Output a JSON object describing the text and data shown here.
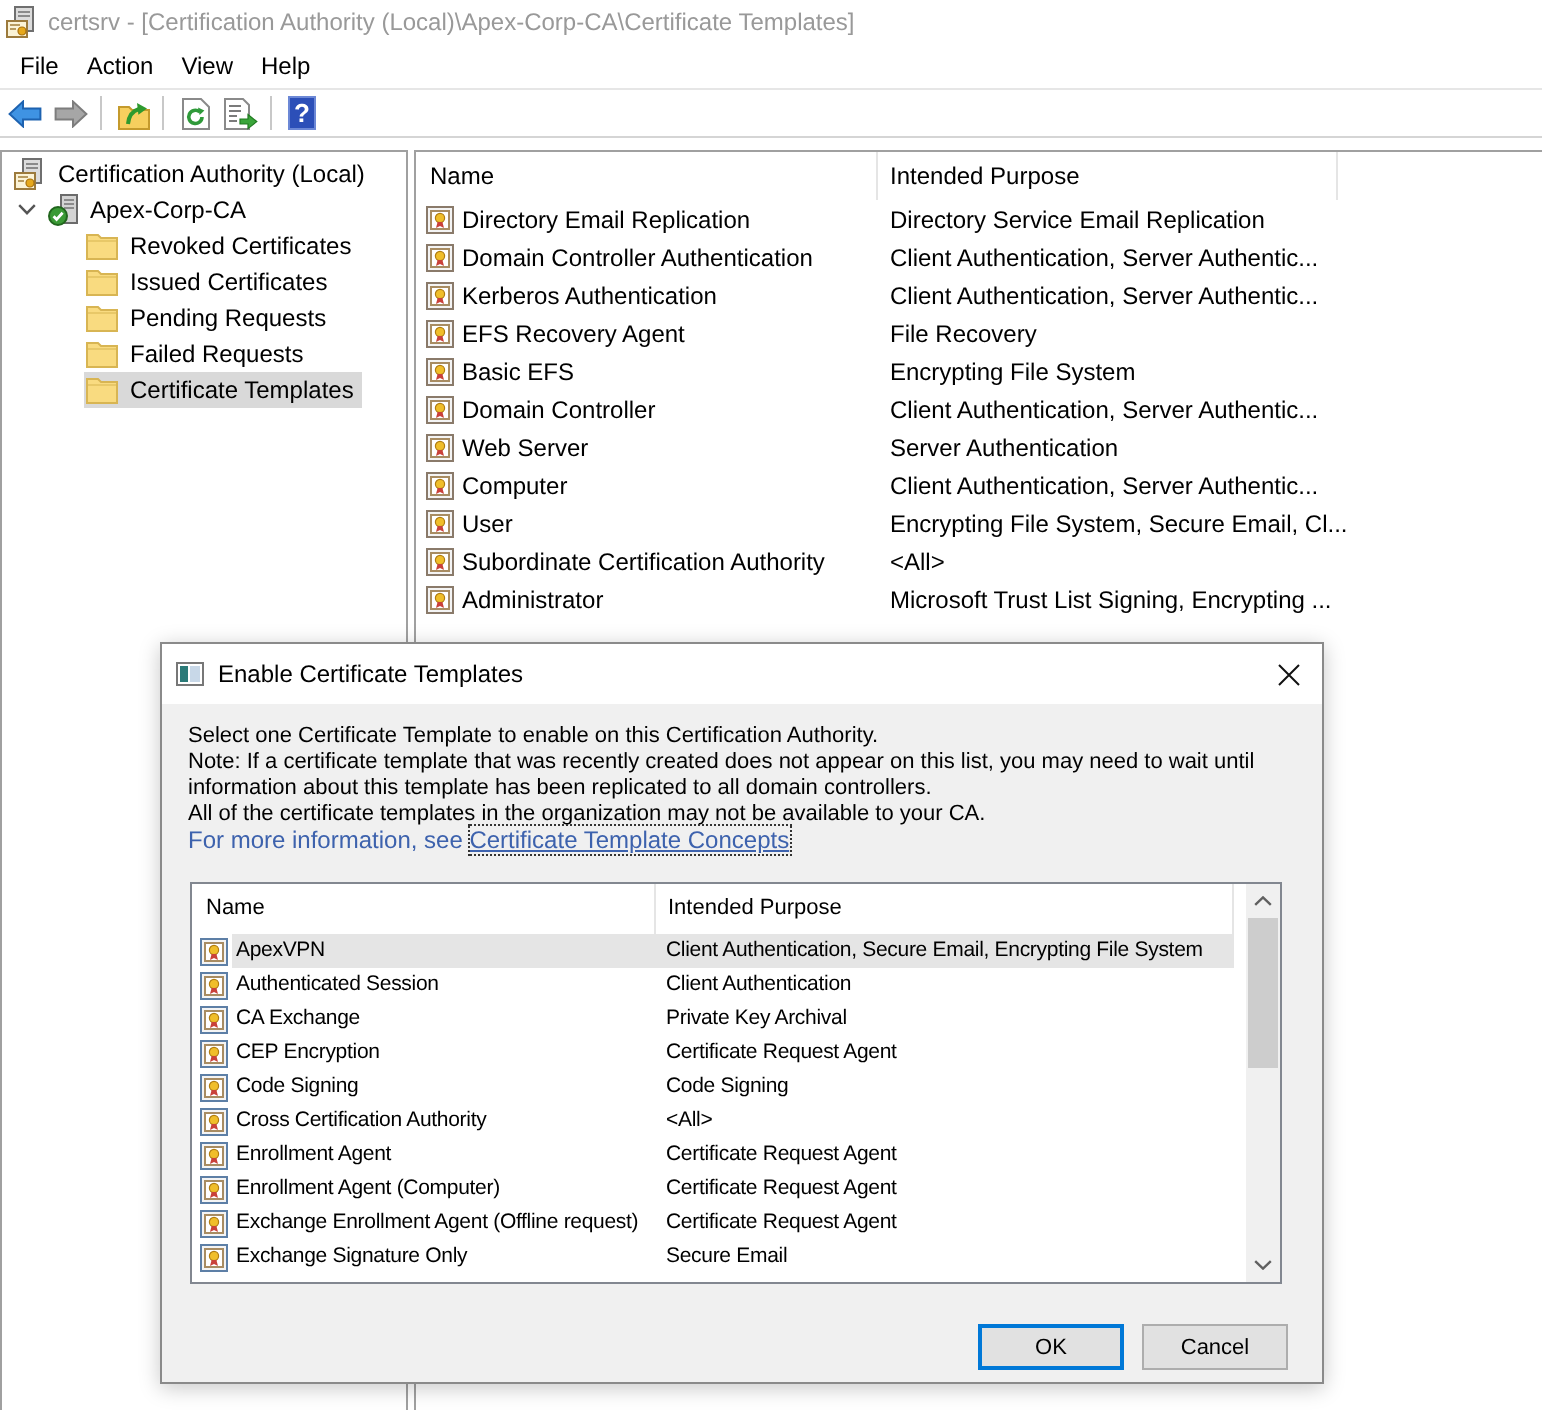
{
  "window": {
    "title": "certsrv - [Certification Authority (Local)\\Apex-Corp-CA\\Certificate Templates]",
    "active": false
  },
  "menu": [
    "File",
    "Action",
    "View",
    "Help"
  ],
  "toolbar": {
    "groups": [
      [
        {
          "kind": "back",
          "disabled": false
        },
        {
          "kind": "forward",
          "disabled": true
        }
      ],
      [
        {
          "kind": "up",
          "disabled": false
        }
      ],
      [
        {
          "kind": "refresh",
          "disabled": false
        },
        {
          "kind": "export",
          "disabled": false
        }
      ],
      [
        {
          "kind": "help",
          "disabled": false,
          "glyph": "?"
        }
      ]
    ]
  },
  "tree": [
    {
      "kind": "root",
      "label": "Certification Authority (Local)",
      "selected": false,
      "children": [
        {
          "kind": "server",
          "label": "Apex-Corp-CA",
          "selected": false,
          "expanded": true,
          "children": [
            {
              "kind": "folder",
              "label": "Revoked Certificates",
              "selected": false
            },
            {
              "kind": "folder",
              "label": "Issued Certificates",
              "selected": false
            },
            {
              "kind": "folder",
              "label": "Pending Requests",
              "selected": false
            },
            {
              "kind": "folder",
              "label": "Failed Requests",
              "selected": false
            },
            {
              "kind": "folder",
              "label": "Certificate Templates",
              "selected": true
            }
          ]
        }
      ]
    }
  ],
  "list": {
    "columns": [
      "Name",
      "Intended Purpose"
    ],
    "rows": [
      {
        "name": "Directory Email Replication",
        "purpose": "Directory Service Email Replication",
        "selected": false
      },
      {
        "name": "Domain Controller Authentication",
        "purpose": "Client Authentication, Server Authentic...",
        "selected": false
      },
      {
        "name": "Kerberos Authentication",
        "purpose": "Client Authentication, Server Authentic...",
        "selected": false
      },
      {
        "name": "EFS Recovery Agent",
        "purpose": "File Recovery",
        "selected": false
      },
      {
        "name": "Basic EFS",
        "purpose": "Encrypting File System",
        "selected": false
      },
      {
        "name": "Domain Controller",
        "purpose": "Client Authentication, Server Authentic...",
        "selected": false
      },
      {
        "name": "Web Server",
        "purpose": "Server Authentication",
        "selected": false
      },
      {
        "name": "Computer",
        "purpose": "Client Authentication, Server Authentic...",
        "selected": false
      },
      {
        "name": "User",
        "purpose": "Encrypting File System, Secure Email, Cl...",
        "selected": false
      },
      {
        "name": "Subordinate Certification Authority",
        "purpose": "<All>",
        "selected": false
      },
      {
        "name": "Administrator",
        "purpose": "Microsoft Trust List Signing, Encrypting ...",
        "selected": false
      }
    ]
  },
  "dialog": {
    "title": "Enable Certificate Templates",
    "message": [
      "Select one Certificate Template to enable on this Certification Authority.",
      "Note: If a certificate template that was recently created does not appear on this list, you may need to wait until information about this template has been replicated to all domain controllers.",
      "All of the certificate templates in the organization may not be available to your CA."
    ],
    "more_info": {
      "text": "For more information, see",
      "link": "Certificate Template Concepts"
    },
    "list": {
      "columns": [
        "Name",
        "Intended Purpose"
      ],
      "rows": [
        {
          "name": "ApexVPN",
          "purpose": "Client Authentication, Secure Email, Encrypting File System",
          "selected": true
        },
        {
          "name": "Authenticated Session",
          "purpose": "Client Authentication",
          "selected": false
        },
        {
          "name": "CA Exchange",
          "purpose": "Private Key Archival",
          "selected": false
        },
        {
          "name": "CEP Encryption",
          "purpose": "Certificate Request Agent",
          "selected": false
        },
        {
          "name": "Code Signing",
          "purpose": "Code Signing",
          "selected": false
        },
        {
          "name": "Cross Certification Authority",
          "purpose": "<All>",
          "selected": false
        },
        {
          "name": "Enrollment Agent",
          "purpose": "Certificate Request Agent",
          "selected": false
        },
        {
          "name": "Enrollment Agent (Computer)",
          "purpose": "Certificate Request Agent",
          "selected": false
        },
        {
          "name": "Exchange Enrollment Agent (Offline request)",
          "purpose": "Certificate Request Agent",
          "selected": false
        },
        {
          "name": "Exchange Signature Only",
          "purpose": "Secure Email",
          "selected": false
        }
      ]
    },
    "buttons": [
      {
        "label": "OK",
        "default": true
      },
      {
        "label": "Cancel",
        "default": false
      }
    ]
  }
}
